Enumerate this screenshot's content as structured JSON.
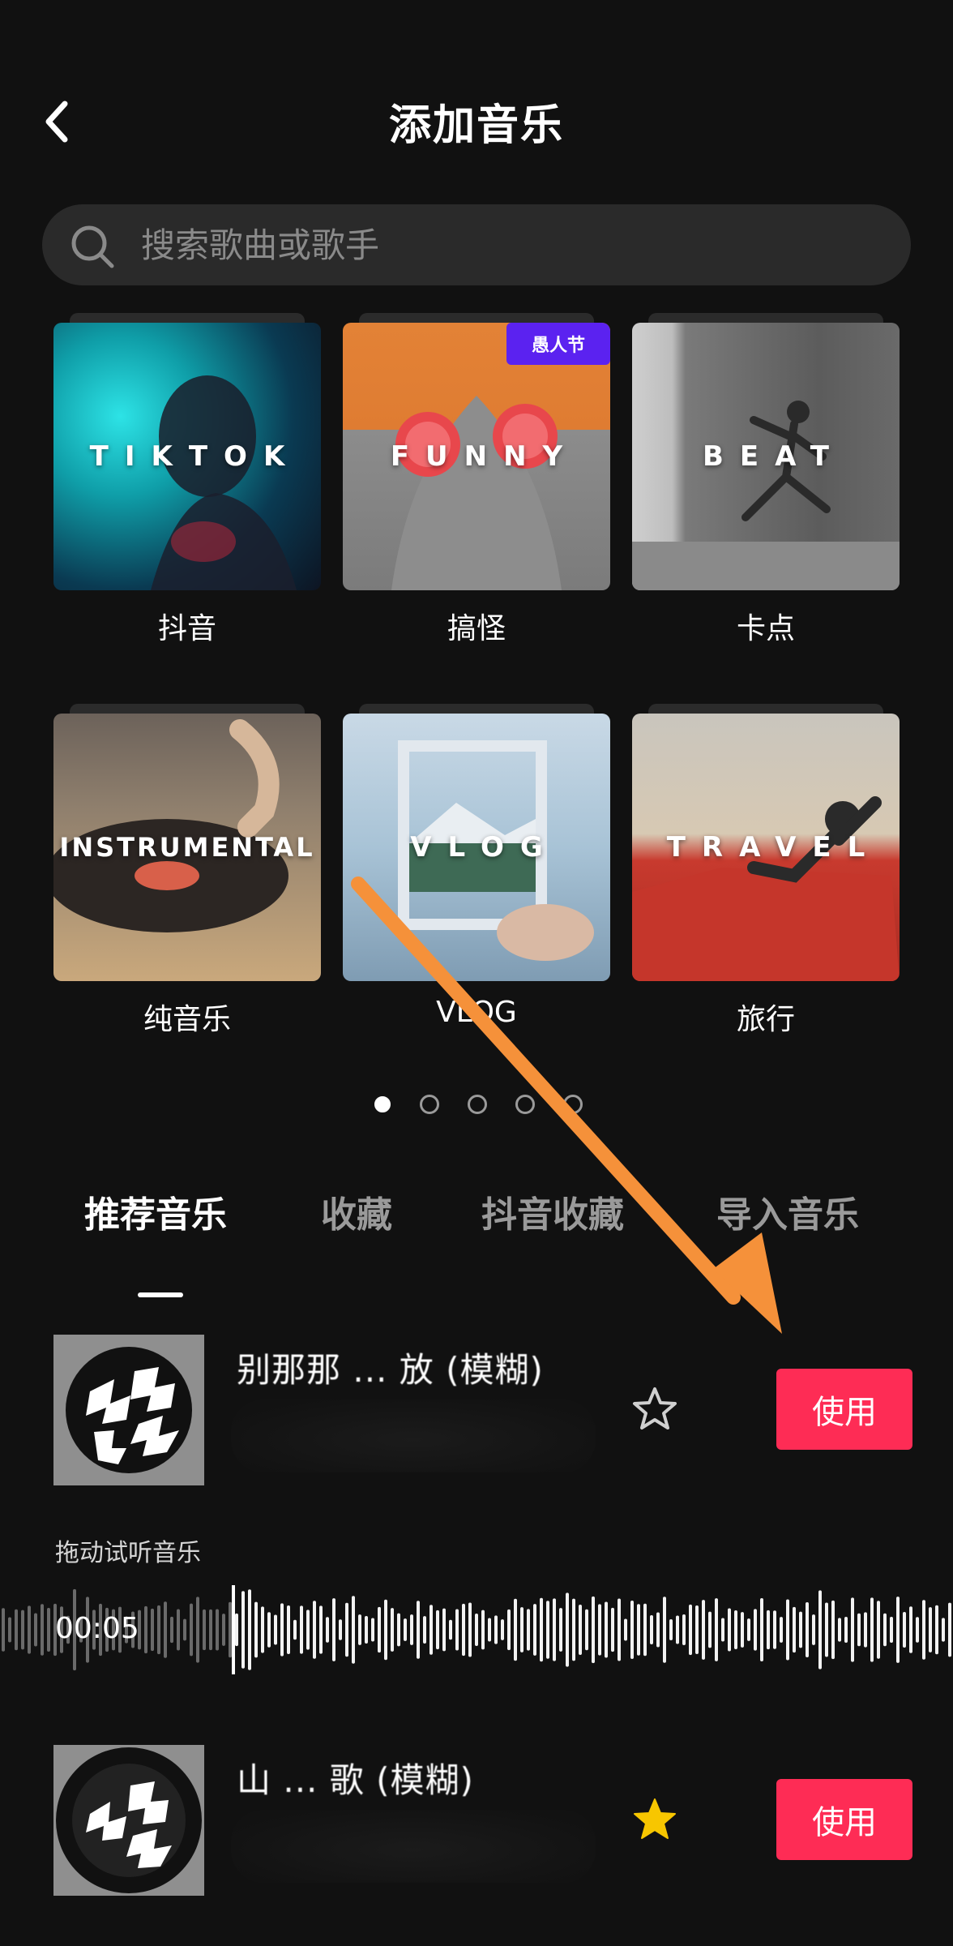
{
  "header": {
    "title": "添加音乐",
    "back_icon": "chevron-left-icon"
  },
  "search": {
    "placeholder": "搜索歌曲或歌手",
    "icon": "search-icon"
  },
  "categories": [
    {
      "label": "抖音",
      "thumb_text": "TIKTOK",
      "badge": ""
    },
    {
      "label": "搞怪",
      "thumb_text": "FUNNY",
      "badge": "愚人节"
    },
    {
      "label": "卡点",
      "thumb_text": "BEAT",
      "badge": ""
    },
    {
      "label": "纯音乐",
      "thumb_text": "INSTRUMENTAL",
      "badge": ""
    },
    {
      "label": "VLOG",
      "thumb_text": "VLOG",
      "badge": ""
    },
    {
      "label": "旅行",
      "thumb_text": "TRAVEL",
      "badge": ""
    }
  ],
  "pager": {
    "total": 5,
    "active": 0
  },
  "tabs": [
    {
      "label": "推荐音乐",
      "active": true
    },
    {
      "label": "收藏",
      "active": false
    },
    {
      "label": "抖音收藏",
      "active": false
    },
    {
      "label": "导入音乐",
      "active": false
    }
  ],
  "songs": [
    {
      "title": "别那那 ... 放 (模糊)",
      "use_label": "使用",
      "favorited": false
    },
    {
      "title": "山 ... 歌 (模糊)",
      "use_label": "使用",
      "favorited": true
    }
  ],
  "preview": {
    "hint": "拖动试听音乐",
    "time": "00:05"
  },
  "colors": {
    "background": "#111111",
    "accent": "#fe2c55",
    "badge": "#5b22f0",
    "annotation_arrow": "#f5913a",
    "star_filled": "#f7c600"
  }
}
